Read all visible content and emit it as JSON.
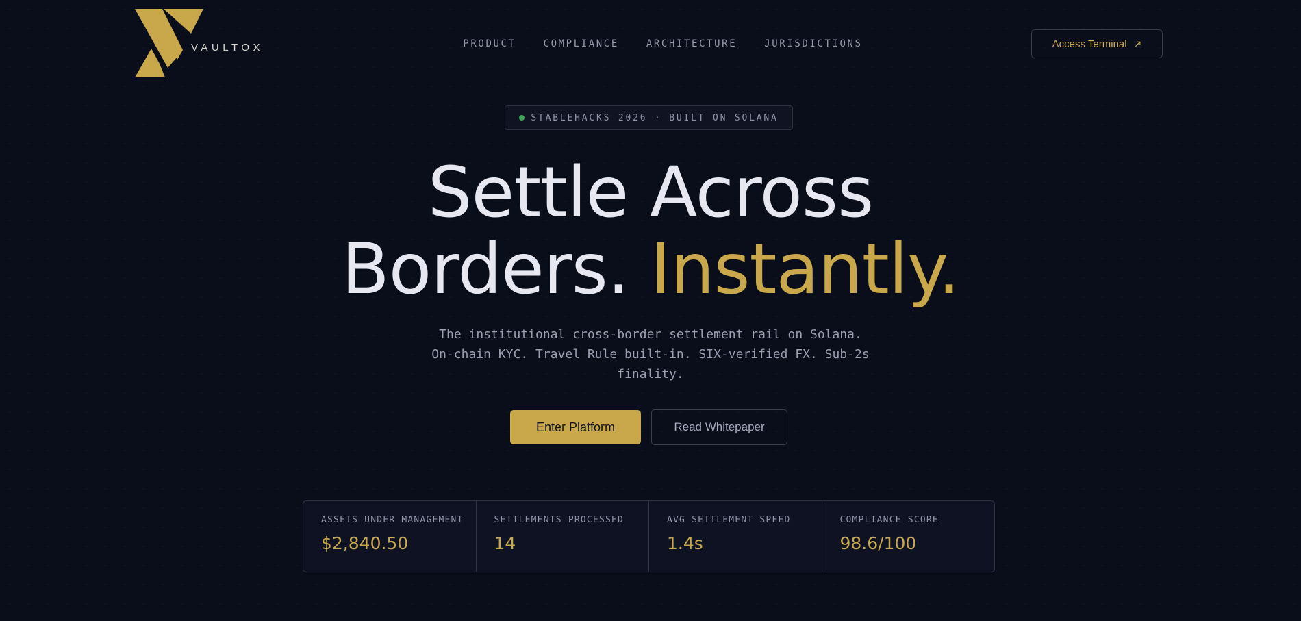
{
  "brand": {
    "name": "VAULTOX",
    "logo_icon": "vaultox-logo-mark",
    "accent": "#c9a84c",
    "background": "#0a0e1a"
  },
  "nav": {
    "items": [
      "PRODUCT",
      "COMPLIANCE",
      "ARCHITECTURE",
      "JURISDICTIONS"
    ]
  },
  "header": {
    "access_label": "Access Terminal",
    "access_icon": "arrow-up-right-icon"
  },
  "hero": {
    "badge": "STABLEHACKS 2026 · BUILT ON SOLANA",
    "badge_status_color": "#3fa65a",
    "headline_line1": "Settle Across",
    "headline_line2_a": "Borders.",
    "headline_line2_b": "Instantly.",
    "subtitle_lines": [
      "The institutional cross-border settlement rail on Solana.",
      "On-chain KYC. Travel Rule built-in. SIX-verified FX. Sub-2s",
      "finality."
    ],
    "primary_cta": "Enter Platform",
    "secondary_cta": "Read Whitepaper"
  },
  "stats": [
    {
      "label": "ASSETS UNDER MANAGEMENT",
      "value": "$2,840.50"
    },
    {
      "label": "SETTLEMENTS PROCESSED",
      "value": "14"
    },
    {
      "label": "AVG SETTLEMENT SPEED",
      "value": "1.4s"
    },
    {
      "label": "COMPLIANCE SCORE",
      "value": "98.6/100"
    }
  ]
}
